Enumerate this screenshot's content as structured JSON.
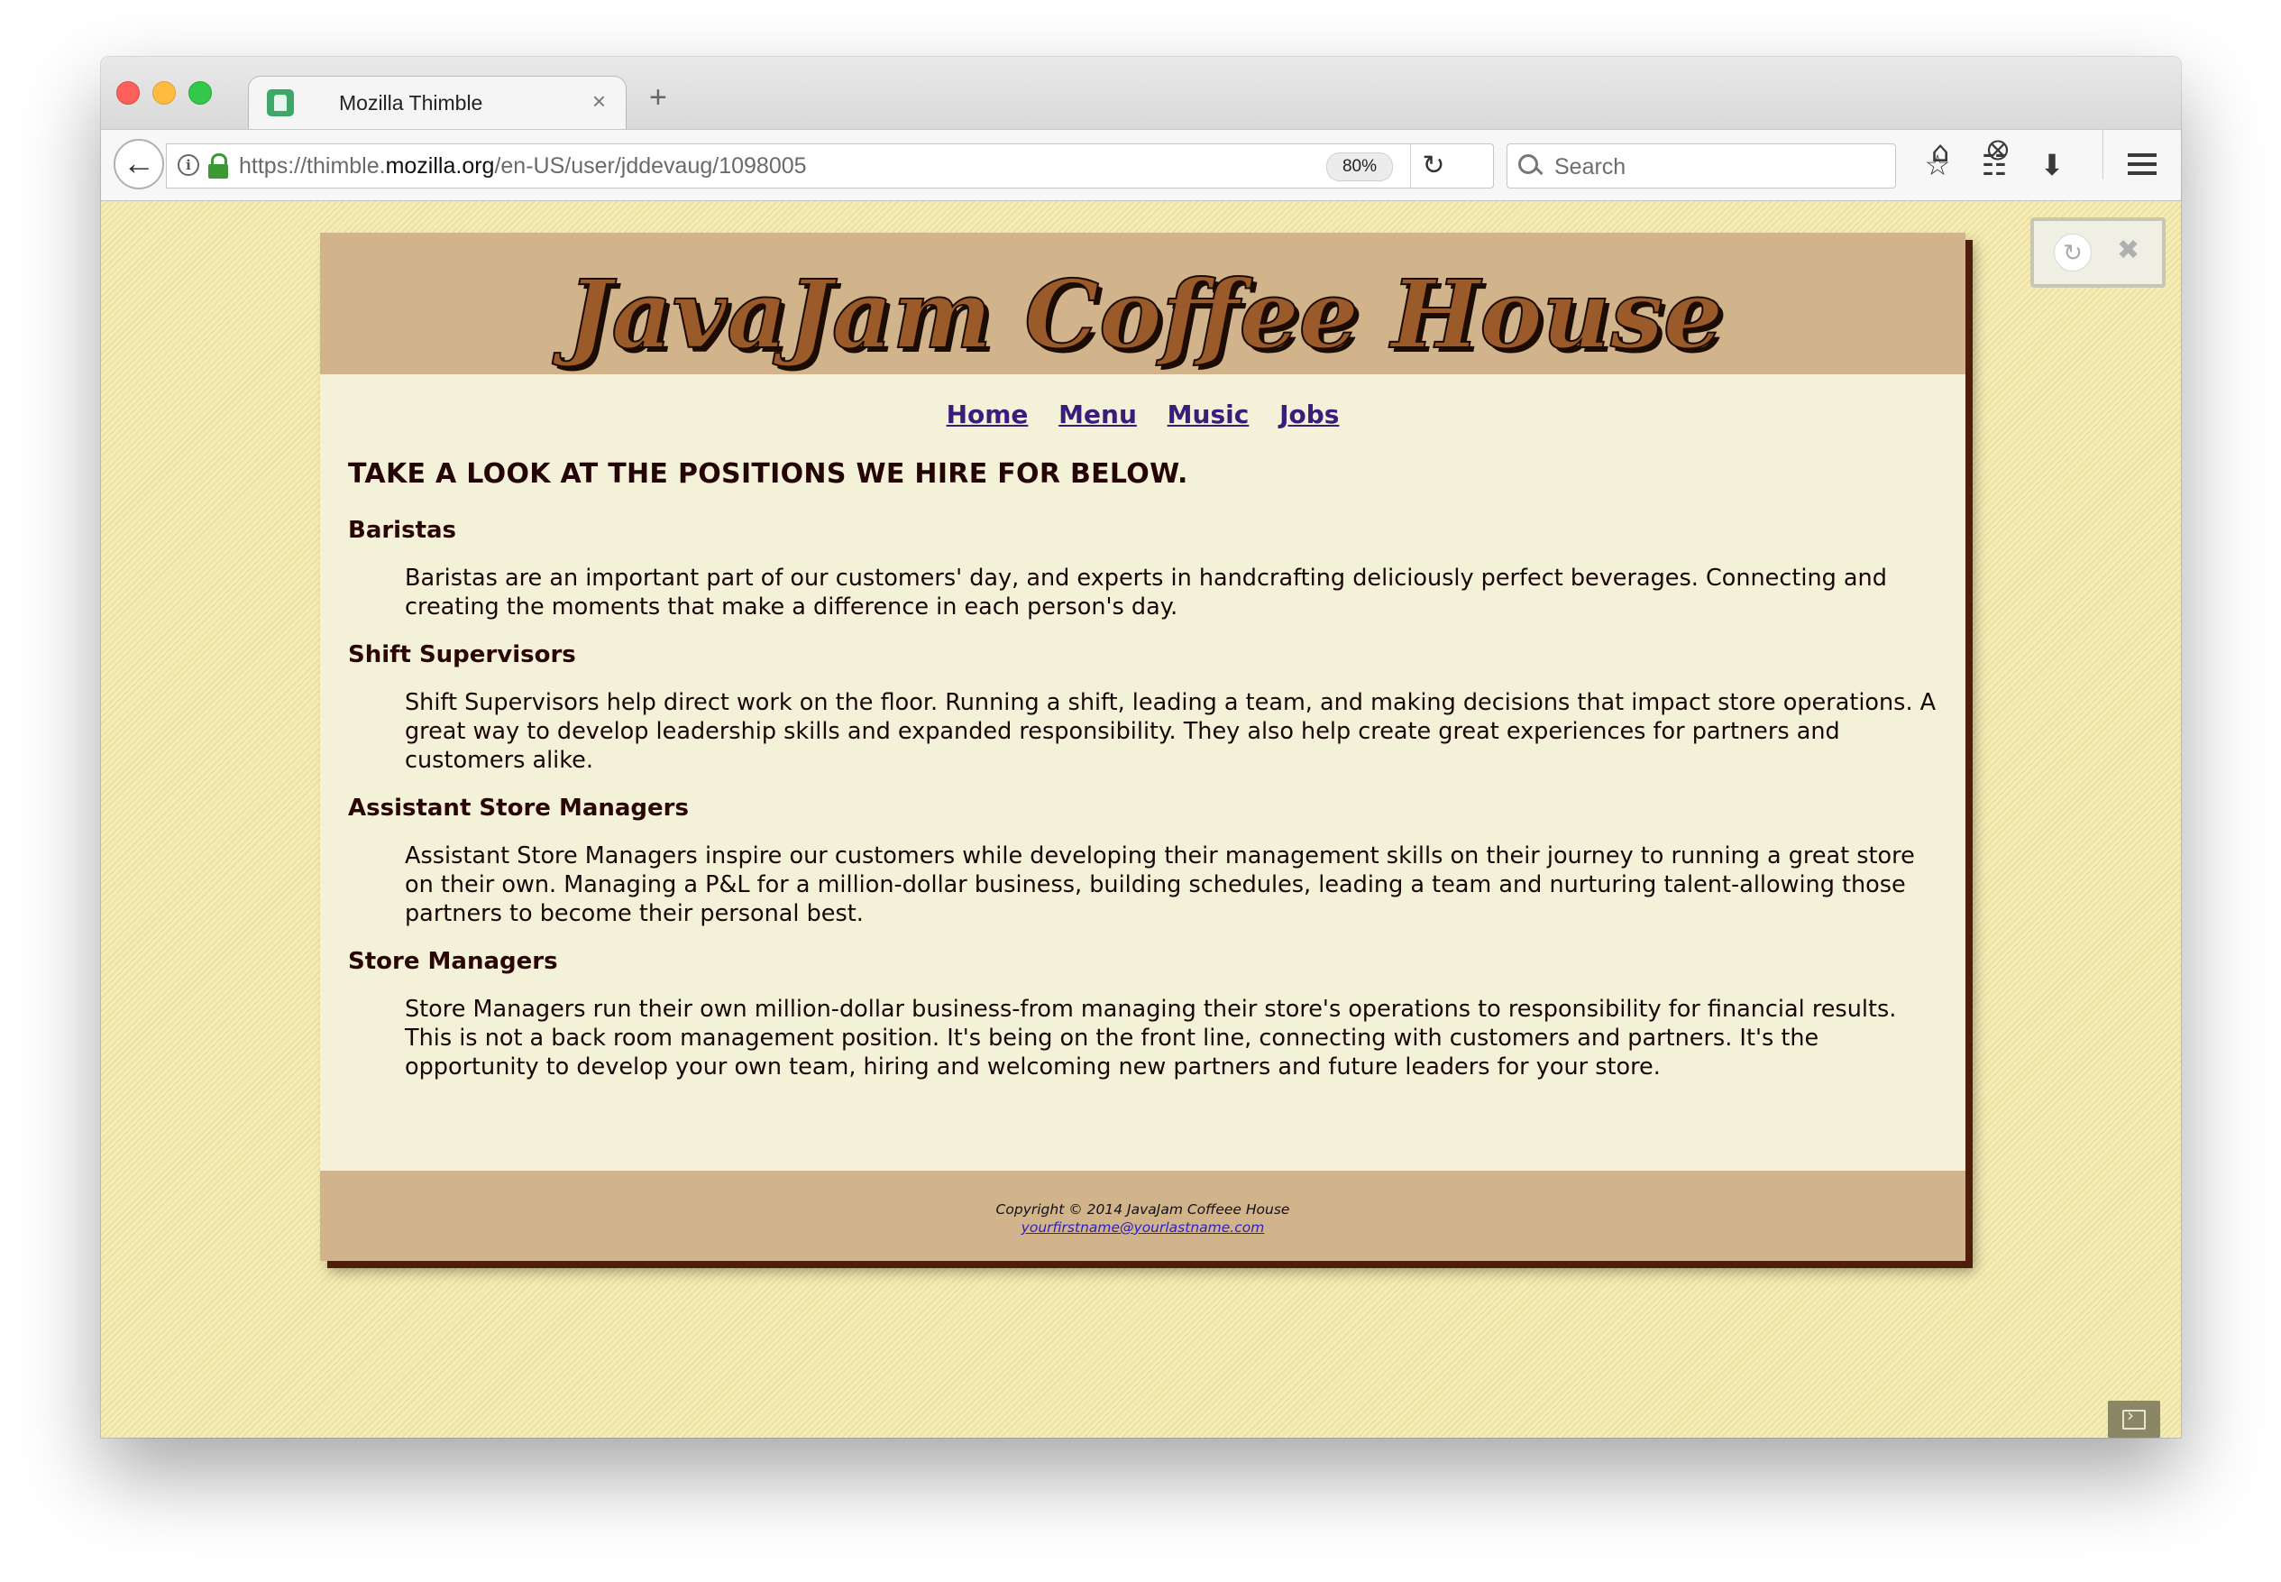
{
  "browser": {
    "tab_title": "Mozilla Thimble",
    "new_tab_label": "+",
    "close_tab_label": "×",
    "url_prefix": "https://thimble.",
    "url_host": "mozilla.org",
    "url_path": "/en-US/user/jddevaug/1098005",
    "zoom": "80%",
    "search_placeholder": "Search"
  },
  "site": {
    "logo_text": "JavaJam Coffee House",
    "nav": [
      "Home",
      "Menu",
      "Music",
      "Jobs"
    ],
    "heading": "TAKE A LOOK AT THE POSITIONS WE HIRE FOR BELOW.",
    "positions": [
      {
        "title": "Baristas",
        "description": "Baristas are an important part of our customers' day, and experts in handcrafting deliciously perfect beverages. Connecting and creating the moments that make a difference in each person's day."
      },
      {
        "title": "Shift Supervisors",
        "description": "Shift Supervisors help direct work on the floor. Running a shift, leading a team, and making decisions that impact store operations. A great way to develop leadership skills and expanded responsibility. They also help create great experiences for partners and customers alike."
      },
      {
        "title": "Assistant Store Managers",
        "description": "Assistant Store Managers inspire our customers while developing their management skills on their journey to running a great store on their own. Managing a P&L for a million-dollar business, building schedules, leading a team and nurturing talent-allowing those partners to become their personal best."
      },
      {
        "title": "Store Managers",
        "description": "Store Managers run their own million-dollar business-from managing their store's operations to responsibility for financial results. This is not a back room management position. It's being on the front line, connecting with customers and partners. It's the opportunity to develop your own team, hiring and welcoming new partners and future leaders for your store."
      }
    ],
    "footer_copyright": "Copyright © 2014 JavaJam Coffeee House",
    "footer_email": "yourfirstname@yourlastname.com"
  },
  "colors": {
    "header_bg": "#d2b48c",
    "content_bg": "#f3f2d8",
    "logo_fill": "#9a5a2a",
    "link": "#3a1c7a"
  }
}
